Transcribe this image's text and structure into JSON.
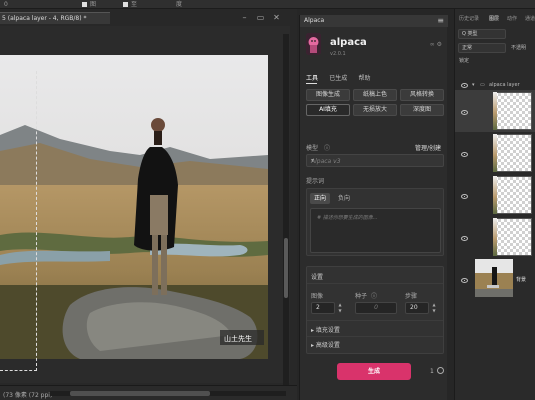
{
  "top_bar": {
    "items": [
      "0",
      "图",
      "至",
      "度"
    ]
  },
  "document": {
    "tab_title": "5 (alpaca layer - 4, RGB/8) *",
    "status_text": "(73 像素 (72 ppi)",
    "watermark": "山土先生"
  },
  "plugin": {
    "panel_title": "Alpaca",
    "app_name": "alpaca",
    "version": "v2.0.1",
    "menu": [
      "工具",
      "已生成",
      "帮助"
    ],
    "tools": [
      "图像生成",
      "纸稿上色",
      "风格转换",
      "AI填充",
      "无损放大",
      "深度图"
    ],
    "selected_tool": "AI填充",
    "model_label": "模型",
    "model_manage": "管理/创建",
    "model_value": "Alpaca v3",
    "prompt_label": "提示词",
    "prompt_tabs": [
      "正向",
      "负向"
    ],
    "prompt_placeholder": "# 描述你想要生成的图像...",
    "settings_label": "设置",
    "fields": {
      "image_label": "图像",
      "image_value": "2",
      "seed_label": "种子",
      "seed_placeholder": "0",
      "steps_label": "步骤",
      "steps_value": "20"
    },
    "expanders": [
      "填充设置",
      "高级设置"
    ],
    "generate_label": "生成",
    "generate_count": "1"
  },
  "layers": {
    "tabs": [
      "历史记录",
      "图层",
      "动作",
      "通道"
    ],
    "active_tab": "图层",
    "kind_filter": "Q 类型",
    "blend_mode": "正常",
    "opacity_label": "不透明",
    "lock_label": "锁定",
    "group_name": "alpaca layer",
    "background_name": "背景",
    "layer_rows": 4
  },
  "colors": {
    "accent": "#d9336b",
    "panel": "#2c2c2c",
    "background": "#262626"
  }
}
